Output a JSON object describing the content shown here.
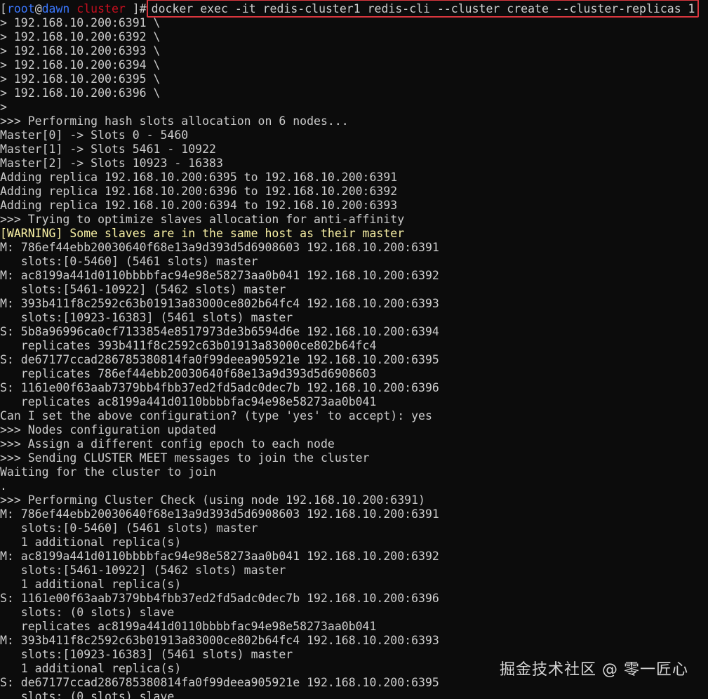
{
  "prompt": {
    "open_bracket": "[",
    "user": "root",
    "at": "@",
    "host": "dawn",
    "dir": " cluster ",
    "close": "]#",
    "command": "docker exec -it redis-cluster1 redis-cli --cluster create --cluster-replicas 1"
  },
  "output_lines": [
    "> 192.168.10.200:6391 \\",
    "> 192.168.10.200:6392 \\",
    "> 192.168.10.200:6393 \\",
    "> 192.168.10.200:6394 \\",
    "> 192.168.10.200:6395 \\",
    "> 192.168.10.200:6396 \\",
    ">",
    ">>> Performing hash slots allocation on 6 nodes...",
    "Master[0] -> Slots 0 - 5460",
    "Master[1] -> Slots 5461 - 10922",
    "Master[2] -> Slots 10923 - 16383",
    "Adding replica 192.168.10.200:6395 to 192.168.10.200:6391",
    "Adding replica 192.168.10.200:6396 to 192.168.10.200:6392",
    "Adding replica 192.168.10.200:6394 to 192.168.10.200:6393",
    ">>> Trying to optimize slaves allocation for anti-affinity",
    "[WARNING] Some slaves are in the same host as their master",
    "M: 786ef44ebb20030640f68e13a9d393d5d6908603 192.168.10.200:6391",
    "   slots:[0-5460] (5461 slots) master",
    "M: ac8199a441d0110bbbbfac94e98e58273aa0b041 192.168.10.200:6392",
    "   slots:[5461-10922] (5462 slots) master",
    "M: 393b411f8c2592c63b01913a83000ce802b64fc4 192.168.10.200:6393",
    "   slots:[10923-16383] (5461 slots) master",
    "S: 5b8a96996ca0cf7133854e8517973de3b6594d6e 192.168.10.200:6394",
    "   replicates 393b411f8c2592c63b01913a83000ce802b64fc4",
    "S: de67177ccad286785380814fa0f99deea905921e 192.168.10.200:6395",
    "   replicates 786ef44ebb20030640f68e13a9d393d5d6908603",
    "S: 1161e00f63aab7379bb4fbb37ed2fd5adc0dec7b 192.168.10.200:6396",
    "   replicates ac8199a441d0110bbbbfac94e98e58273aa0b041",
    "Can I set the above configuration? (type 'yes' to accept): yes",
    ">>> Nodes configuration updated",
    ">>> Assign a different config epoch to each node",
    ">>> Sending CLUSTER MEET messages to join the cluster",
    "Waiting for the cluster to join",
    ".",
    ">>> Performing Cluster Check (using node 192.168.10.200:6391)",
    "M: 786ef44ebb20030640f68e13a9d393d5d6908603 192.168.10.200:6391",
    "   slots:[0-5460] (5461 slots) master",
    "   1 additional replica(s)",
    "M: ac8199a441d0110bbbbfac94e98e58273aa0b041 192.168.10.200:6392",
    "   slots:[5461-10922] (5462 slots) master",
    "   1 additional replica(s)",
    "S: 1161e00f63aab7379bb4fbb37ed2fd5adc0dec7b 192.168.10.200:6396",
    "   slots: (0 slots) slave",
    "   replicates ac8199a441d0110bbbbfac94e98e58273aa0b041",
    "M: 393b411f8c2592c63b01913a83000ce802b64fc4 192.168.10.200:6393",
    "   slots:[10923-16383] (5461 slots) master",
    "   1 additional replica(s)",
    "S: de67177ccad286785380814fa0f99deea905921e 192.168.10.200:6395",
    "   slots: (0 slots) slave"
  ],
  "warning_prefix": "[WARNING]",
  "watermark": "掘金技术社区 @ 零一匠心",
  "colors": {
    "background": "#0c0c0c",
    "text": "#cccccc",
    "prompt_blue": "#3b78ff",
    "prompt_red": "#c50f1f",
    "warning_yellow": "#f9f1a5",
    "highlight_border": "#d9363e"
  }
}
